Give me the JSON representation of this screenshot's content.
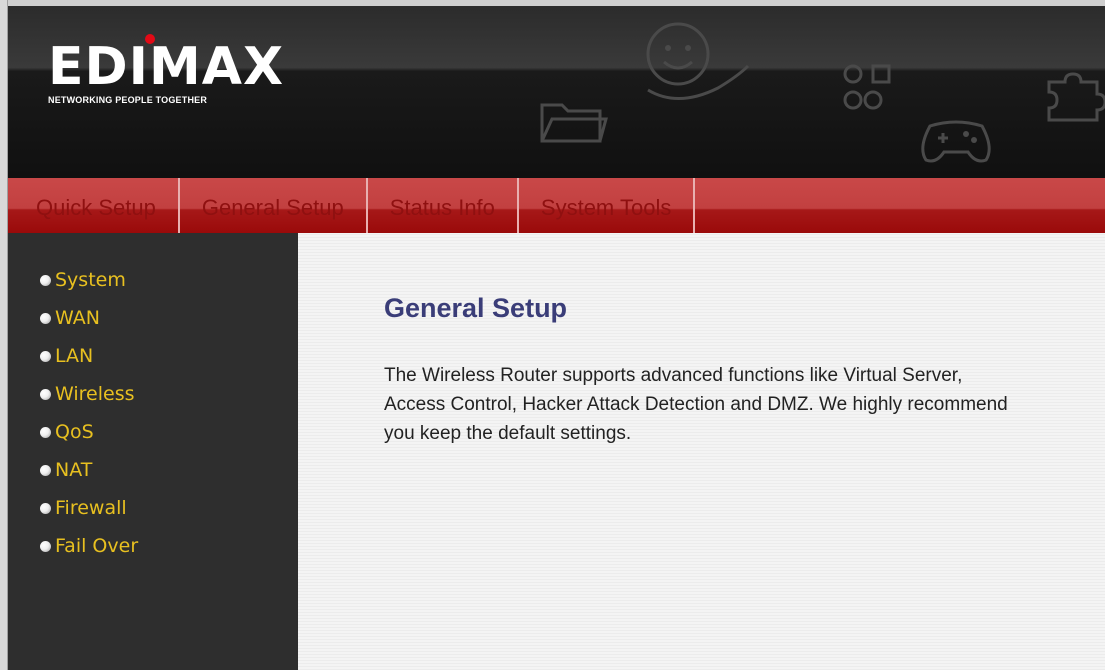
{
  "brand": {
    "logo_text": "EDIMAX",
    "tagline": "NETWORKING PEOPLE TOGETHER"
  },
  "nav": {
    "tabs": [
      {
        "label": "Quick Setup"
      },
      {
        "label": "General Setup"
      },
      {
        "label": "Status Info"
      },
      {
        "label": "System Tools"
      }
    ]
  },
  "sidebar": {
    "items": [
      {
        "label": "System"
      },
      {
        "label": "WAN"
      },
      {
        "label": "LAN"
      },
      {
        "label": "Wireless"
      },
      {
        "label": "QoS"
      },
      {
        "label": "NAT"
      },
      {
        "label": "Firewall"
      },
      {
        "label": "Fail Over"
      }
    ]
  },
  "main": {
    "title": "General Setup",
    "description": "The Wireless Router supports advanced functions like Virtual Server, Access Control, Hacker Attack Detection and DMZ. We highly recommend you keep the default settings."
  },
  "icons": [
    "folder-icon",
    "smiley-hand-icon",
    "network-nodes-icon",
    "gamepad-icon",
    "puzzle-icon"
  ],
  "colors": {
    "header_bg": "#1a1a1a",
    "nav_bar": "#b52a2a",
    "nav_text": "#8f1010",
    "sidebar_bg": "#2e2e2e",
    "sidebar_text": "#e8c020",
    "logo_dot": "#e20a16",
    "title_color": "#3a3d78"
  }
}
